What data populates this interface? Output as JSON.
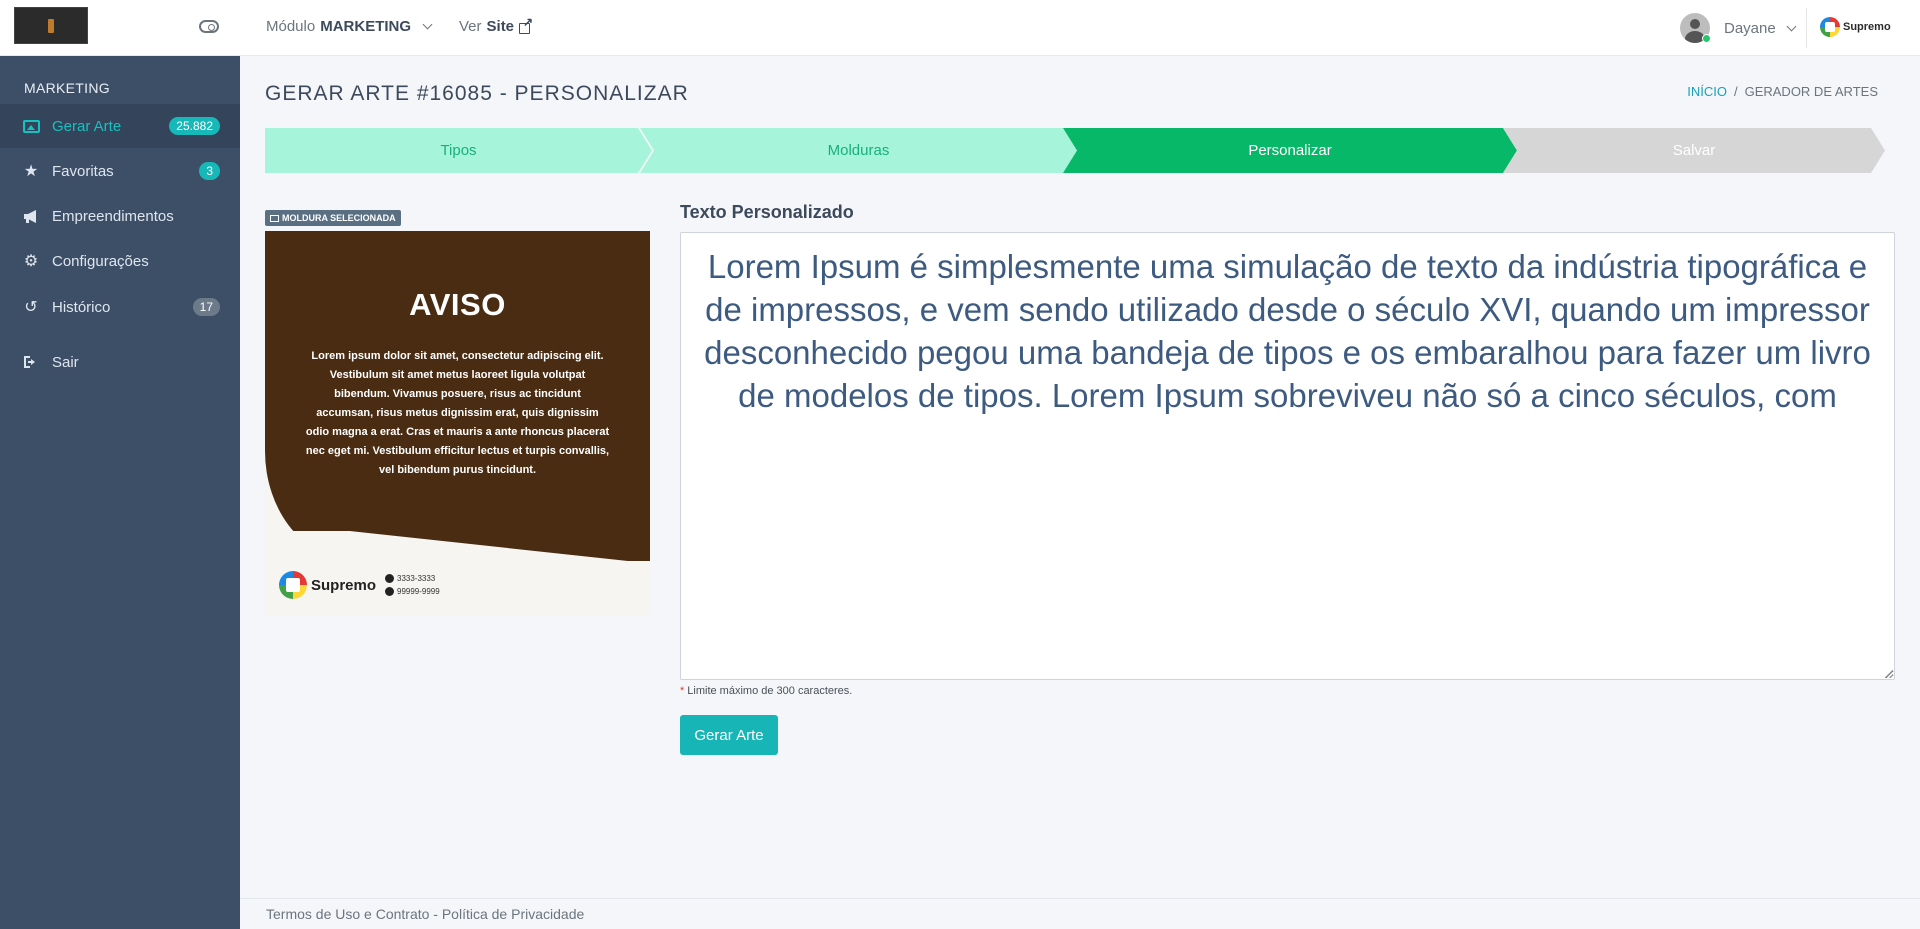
{
  "topbar": {
    "modulo_prefix": "Módulo",
    "modulo_name": "MARKETING",
    "versite_prefix": "Ver",
    "versite_name": "Site",
    "user_name": "Dayane",
    "brand_name": "Supremo"
  },
  "sidebar": {
    "heading": "MARKETING",
    "items": [
      {
        "label": "Gerar Arte",
        "icon": "image-icon",
        "badge": "25.882",
        "active": true
      },
      {
        "label": "Favoritas",
        "icon": "star-icon",
        "badge": "3"
      },
      {
        "label": "Empreendimentos",
        "icon": "bullhorn-icon"
      },
      {
        "label": "Configurações",
        "icon": "cogs-icon"
      },
      {
        "label": "Histórico",
        "icon": "history-icon",
        "badge": "17"
      },
      {
        "label": "Sair",
        "icon": "sign-out-icon"
      }
    ]
  },
  "page": {
    "title": "GERAR ARTE #16085 - PERSONALIZAR",
    "breadcrumb": {
      "home": "INÍCIO",
      "separator": "/",
      "current": "GERADOR DE ARTES"
    }
  },
  "steps": [
    {
      "label": "Tipos",
      "state": "done"
    },
    {
      "label": "Molduras",
      "state": "done"
    },
    {
      "label": "Personalizar",
      "state": "current"
    },
    {
      "label": "Salvar",
      "state": "todo"
    }
  ],
  "preview": {
    "tag": "MOLDURA SELECIONADA",
    "art_title": "AVISO",
    "art_body": "Lorem ipsum dolor sit amet, consectetur adipiscing elit. Vestibulum sit amet metus laoreet ligula volutpat bibendum. Vivamus posuere, risus ac tincidunt accumsan, risus metus dignissim erat, quis dignissim odio magna a erat. Cras et mauris a ante rhoncus placerat nec eget mi. Vestibulum efficitur lectus et turpis convallis, vel bibendum purus tincidunt.",
    "art_brand": "Supremo",
    "art_phone_1": "3333-3333",
    "art_phone_2": "99999-9999"
  },
  "form": {
    "label": "Texto Personalizado",
    "value": "Lorem Ipsum é simplesmente uma simulação de texto da indústria tipográfica e de impressos, e vem sendo utilizado desde o século XVI, quando um impressor desconhecido pegou uma bandeja de tipos e os embaralhou para fazer um livro de modelos de tipos. Lorem Ipsum sobreviveu não só a cinco séculos, com",
    "hint_asterisk": "*",
    "hint": "Limite máximo de 300 caracteres.",
    "submit": "Gerar Arte"
  },
  "footer": {
    "text": "Termos de Uso e Contrato - Política de Privacidade"
  },
  "colors": {
    "sidebar": "#3d4f67",
    "accent": "#17b5b5",
    "step_current": "#07b868",
    "step_done": "#a6f5da",
    "art_brown": "#4a2c12"
  }
}
